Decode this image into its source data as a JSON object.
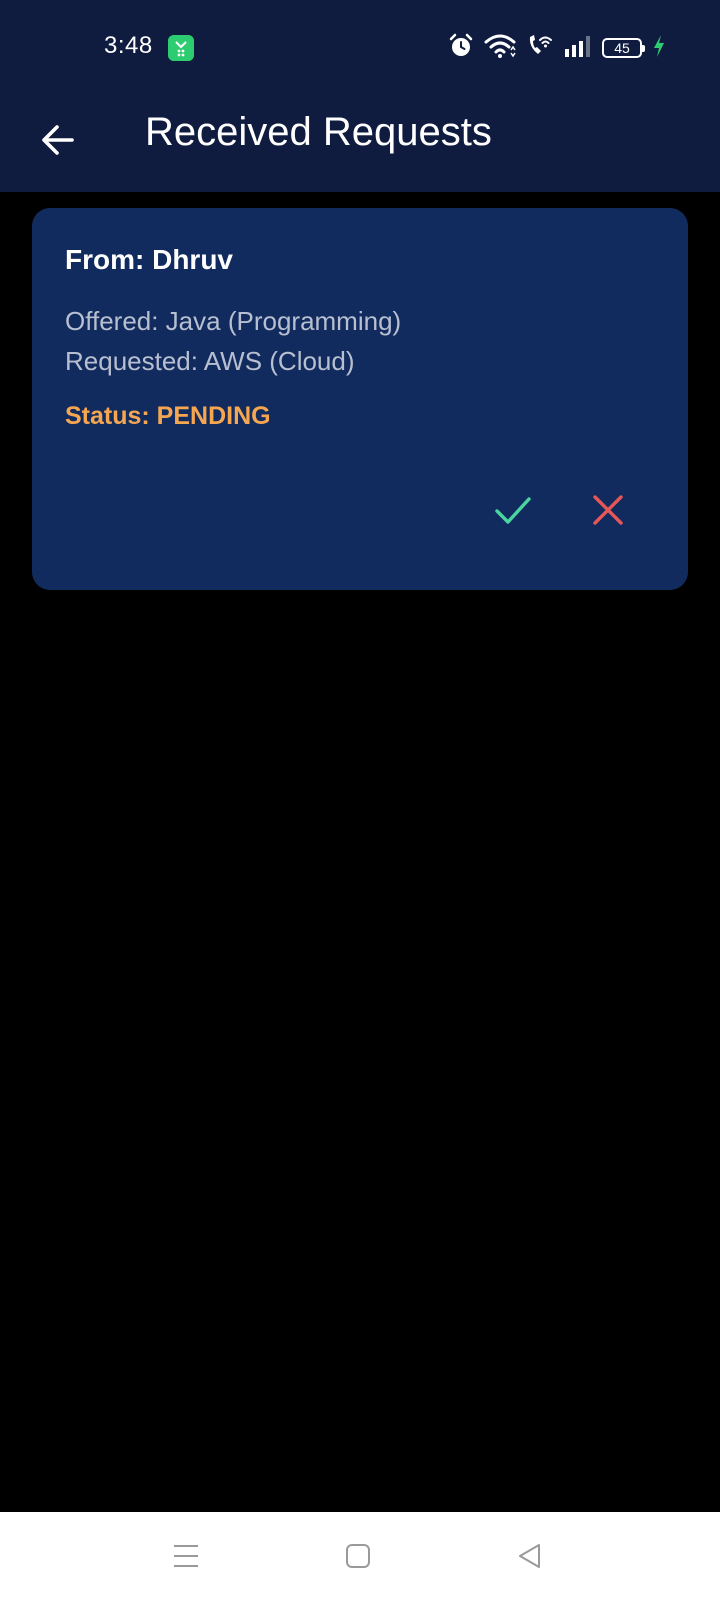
{
  "status_bar": {
    "time": "3:48",
    "battery_level": "45",
    "icons": [
      "alarm-icon",
      "wifi-icon",
      "wifi-calling-icon",
      "signal-icon",
      "battery-icon",
      "charging-icon"
    ]
  },
  "app_bar": {
    "title": "Received Requests",
    "back_icon": "arrow-left-icon"
  },
  "requests": [
    {
      "from": "From: Dhruv",
      "offered": "Offered: Java (Programming)",
      "requested": "Requested: AWS (Cloud)",
      "status": "Status: PENDING",
      "accept_icon": "check-icon",
      "reject_icon": "close-icon"
    }
  ],
  "colors": {
    "app_bar_bg": "#0f1c3f",
    "card_bg": "#122b5e",
    "status_pending": "#f5a651",
    "accept": "#4ad6a0",
    "reject": "#e85757",
    "screen_bg": "#000000"
  },
  "nav_bar": {
    "icons": [
      "menu-icon",
      "home-icon",
      "back-triangle-icon"
    ]
  }
}
